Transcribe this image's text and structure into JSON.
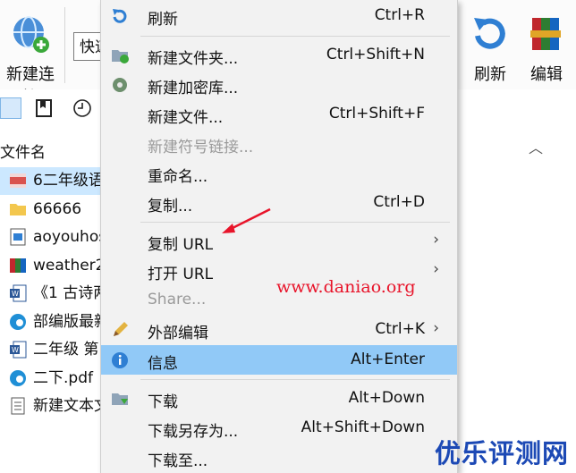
{
  "toolbar": {
    "new_connection_label": "新建连接",
    "quick_connect_value": "快速",
    "refresh_label": "刷新",
    "edit_label": "编辑"
  },
  "file_list": {
    "column_name": "文件名",
    "files": [
      {
        "name": "6二年级语",
        "icon": "mp4-file-icon",
        "selected": true
      },
      {
        "name": "66666",
        "icon": "folder-icon",
        "selected": false
      },
      {
        "name": "aoyouhost",
        "icon": "image-file-icon",
        "selected": false
      },
      {
        "name": "weather2",
        "icon": "archive-file-icon",
        "selected": false
      },
      {
        "name": "《1 古诗两",
        "icon": "word-file-icon",
        "selected": false
      },
      {
        "name": "部编版最新",
        "icon": "edge-pdf-icon",
        "selected": false
      },
      {
        "name": "二年级 第",
        "icon": "word-file-icon",
        "selected": false
      },
      {
        "name": "二下.pdf",
        "icon": "edge-pdf-icon",
        "selected": false
      },
      {
        "name": "新建文本文",
        "icon": "text-file-icon",
        "selected": false
      }
    ]
  },
  "context_menu": {
    "items": [
      {
        "label": "刷新",
        "shortcut": "Ctrl+R"
      },
      {
        "label": "新建文件夹...",
        "shortcut": "Ctrl+Shift+N"
      },
      {
        "label": "新建加密库...",
        "shortcut": ""
      },
      {
        "label": "新建文件...",
        "shortcut": "Ctrl+Shift+F"
      },
      {
        "label": "新建符号链接...",
        "shortcut": ""
      },
      {
        "label": "重命名...",
        "shortcut": ""
      },
      {
        "label": "复制...",
        "shortcut": "Ctrl+D"
      },
      {
        "label": "复制 URL",
        "shortcut": ""
      },
      {
        "label": "打开 URL",
        "shortcut": ""
      },
      {
        "label": "Share...",
        "shortcut": ""
      },
      {
        "label": "外部编辑",
        "shortcut": "Ctrl+K"
      },
      {
        "label": "信息",
        "shortcut": "Alt+Enter"
      },
      {
        "label": "下载",
        "shortcut": "Alt+Down"
      },
      {
        "label": "下载另存为...",
        "shortcut": "Alt+Shift+Down"
      },
      {
        "label": "下载至...",
        "shortcut": ""
      }
    ]
  },
  "watermark": {
    "url": "www.daniao.org",
    "site_name": "优乐评测网"
  },
  "colors": {
    "menu_background": "#f2f2f2",
    "menu_highlight": "#91c9f7",
    "row_selected": "#cce8ff",
    "watermark_red": "#e8142a",
    "logo_blue": "#1c49b5"
  }
}
